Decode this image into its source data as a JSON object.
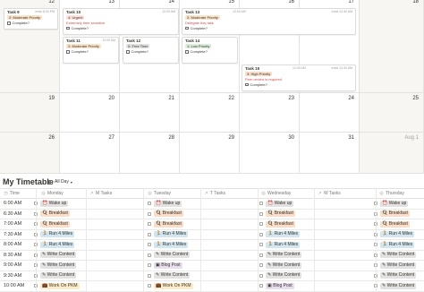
{
  "calendar": {
    "week1": {
      "days": [
        "12",
        "13",
        "14",
        "15",
        "16",
        "17",
        "18"
      ]
    },
    "week2": {
      "days": [
        "19",
        "20",
        "21",
        "22",
        "23",
        "24",
        "25"
      ]
    },
    "week3": {
      "days": [
        "26",
        "27",
        "28",
        "29",
        "30",
        "31",
        "Aug 1"
      ]
    },
    "cards": [
      {
        "title": "Task 9",
        "time": "",
        "tag": "2: Moderate Priority",
        "tag_color": "#fae3c9",
        "warning": "",
        "check": "Complete?"
      },
      {
        "title": "Task 10",
        "time": "12:00 AM",
        "tag": "4: Urgent",
        "tag_color": "#ffe2dd",
        "warning": "Extremely time sensitive",
        "check": "Complete?"
      },
      {
        "title": "Task 13",
        "time": "12:00 AM",
        "tag": "2: Moderate Priority",
        "tag_color": "#fae3c9",
        "warning": "Delegate this task",
        "check": "Complete?"
      },
      {
        "title": "Task 11",
        "time": "12:00 AM",
        "tag": "2: Moderate Priority",
        "tag_color": "#fae3c9",
        "warning": "",
        "check": "Complete?"
      },
      {
        "title": "Task 12",
        "time": "",
        "tag": "0: Free Time",
        "tag_color": "#e3e2e0",
        "warning": "",
        "check": "Complete?"
      },
      {
        "title": "Task 14",
        "time": "",
        "tag": "1: Low Priority",
        "tag_color": "#dbeddb",
        "warning": "",
        "check": "Complete?"
      },
      {
        "title": "Task 15",
        "time": "12:00 AM",
        "tag": "3: High Priority",
        "tag_color": "#fadec9",
        "warning": "Peer review is required",
        "check": "Complete?"
      }
    ],
    "ends_9": "ends 8:00 PM",
    "ends_13": "ends 12:00 AM",
    "ends_15": "ends 12:00 AM"
  },
  "timetable": {
    "title": "My Timetable",
    "view": "All Day",
    "columns": [
      "Time",
      "Monday",
      "M Tasks",
      "Tuesday",
      "T Tasks",
      "Wednesday",
      "W Tasks",
      "Thursday"
    ],
    "rows": [
      {
        "time": "6:00 AM",
        "monday": "Wake up",
        "tuesday": "Wake up",
        "wednesday": "Wake up",
        "thursday": "Wake up",
        "icon": "⏰",
        "color": "#e3e2e0"
      },
      {
        "time": "6:30 AM",
        "monday": "Breakfast",
        "tuesday": "Breakfast",
        "wednesday": "Breakfast",
        "thursday": "Breakfast",
        "icon": "🍳",
        "color": "#fadec9"
      },
      {
        "time": "7:00 AM",
        "monday": "Breakfast",
        "tuesday": "Breakfast",
        "wednesday": "Breakfast",
        "thursday": "Breakfast",
        "icon": "🍳",
        "color": "#fadec9"
      },
      {
        "time": "7:30 AM",
        "monday": "Run 4 Miles",
        "tuesday": "Run 4 Miles",
        "wednesday": "Run 4 Miles",
        "thursday": "Run 4 Miles",
        "icon": "🏃",
        "color": "#d3e5ef"
      },
      {
        "time": "8:00 AM",
        "monday": "Run 4 Miles",
        "tuesday": "Run 4 Miles",
        "wednesday": "Run 4 Miles",
        "thursday": "Run 4 Miles",
        "icon": "🏃",
        "color": "#d3e5ef"
      },
      {
        "time": "8:30 AM",
        "monday": "Write Content",
        "tuesday": "Write Content",
        "wednesday": "Write Content",
        "thursday": "Write Content",
        "icon": "✍",
        "color": "#e3e2e0"
      },
      {
        "time": "9:00 AM",
        "monday": "Write Content",
        "tuesday": "Blog Post",
        "wednesday": "Write Content",
        "thursday": "Write Content",
        "icon": "✍",
        "color": "#e3e2e0"
      },
      {
        "time": "9:30 AM",
        "monday": "Write Content",
        "tuesday": "Write Content",
        "wednesday": "Write Content",
        "thursday": "Write Content",
        "icon": "✍",
        "color": "#e3e2e0"
      },
      {
        "time": "10:00 AM",
        "monday": "Work On PKM",
        "tuesday": "Work On PKM",
        "wednesday": "Blog Post",
        "thursday": "Write Content",
        "icon": "💼",
        "color": "#fdecc8"
      }
    ]
  }
}
